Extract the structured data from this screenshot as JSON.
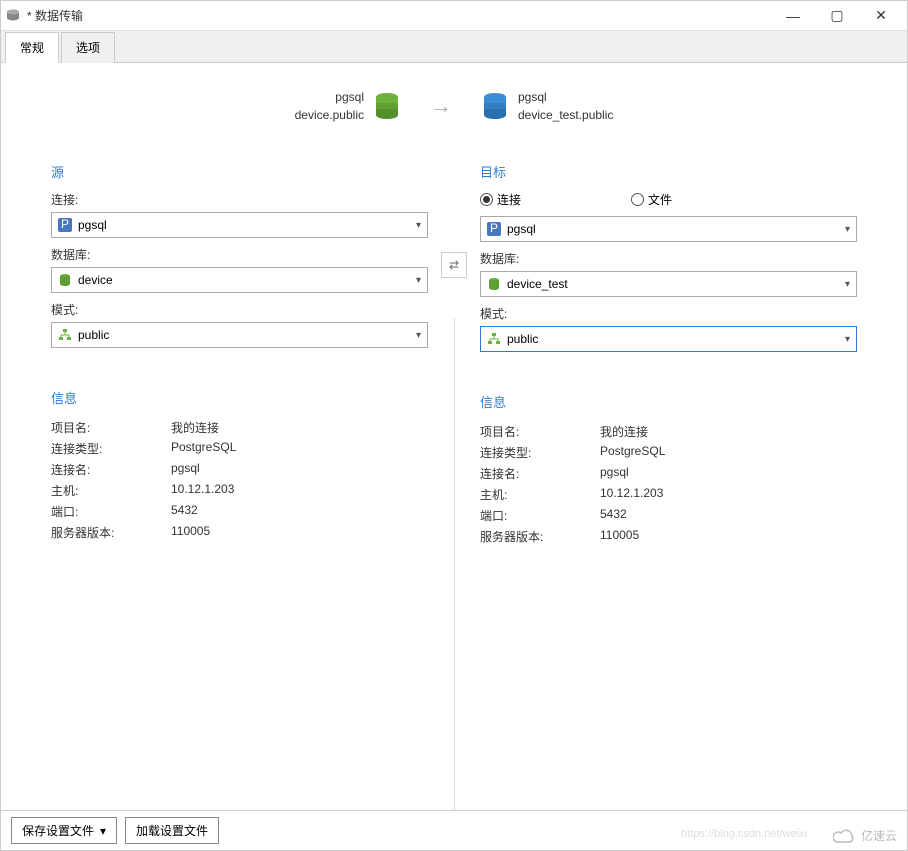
{
  "window": {
    "title": "* 数据传输",
    "min": "—",
    "max": "▢",
    "close": "✕"
  },
  "tabs": {
    "general": "常规",
    "options": "选项"
  },
  "summary": {
    "source_conn": "pgsql",
    "source_db": "device.public",
    "target_conn": "pgsql",
    "target_db": "device_test.public"
  },
  "source": {
    "title": "源",
    "connection_label": "连接:",
    "connection_value": "pgsql",
    "database_label": "数据库:",
    "database_value": "device",
    "schema_label": "模式:",
    "schema_value": "public"
  },
  "target": {
    "title": "目标",
    "radio_connection": "连接",
    "radio_file": "文件",
    "connection_value": "pgsql",
    "database_label": "数据库:",
    "database_value": "device_test",
    "schema_label": "模式:",
    "schema_value": "public"
  },
  "info": {
    "title": "信息",
    "rows": {
      "project_name_key": "项目名:",
      "project_name_val": "我的连接",
      "conn_type_key": "连接类型:",
      "conn_type_val": "PostgreSQL",
      "conn_name_key": "连接名:",
      "conn_name_val": "pgsql",
      "host_key": "主机:",
      "host_val": "10.12.1.203",
      "port_key": "端口:",
      "port_val": "5432",
      "server_ver_key": "服务器版本:",
      "server_ver_val": "110005"
    }
  },
  "footer": {
    "save_profile": "保存设置文件",
    "load_profile": "加载设置文件"
  },
  "watermark": {
    "text": "亿速云",
    "url": "https://blog.csdn.net/weixi"
  }
}
